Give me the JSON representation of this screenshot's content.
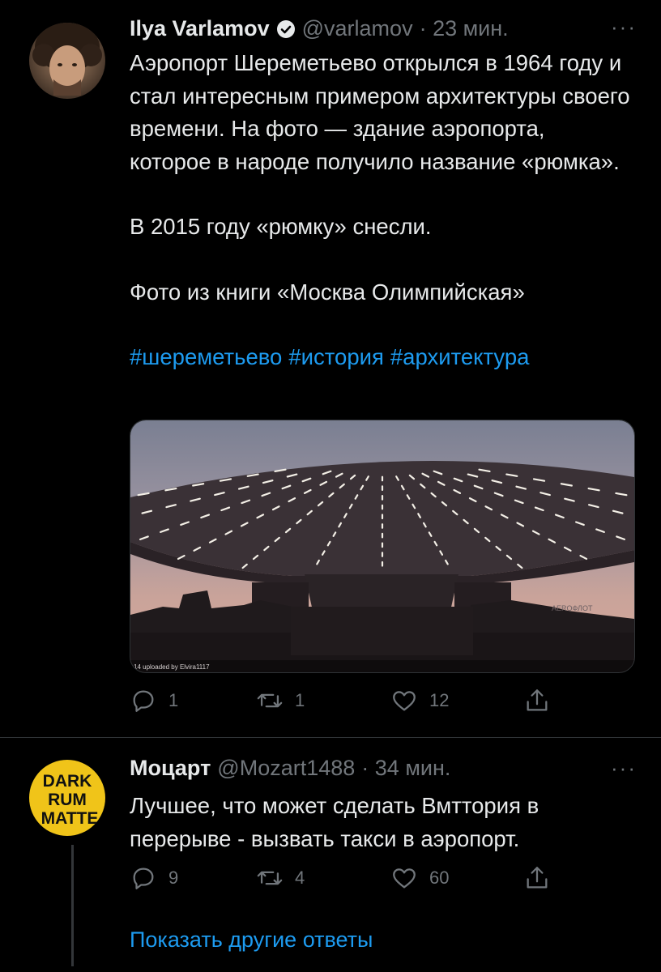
{
  "main_tweet": {
    "author_name": "Ilya Varlamov",
    "handle": "@varlamov",
    "time": "· 23 мин.",
    "more": "···",
    "paragraphs": [
      "Аэропорт Шереметьево открылся в 1964 году и стал интересным примером архитектуры своего времени. На фото — здание аэропорта, которое в народе получило название «рюмка».",
      "В 2015 году «рюмку» снесли.",
      "Фото из книги «Москва Олимпийская»"
    ],
    "hashtags": [
      "#шереметьево",
      "#история",
      "#архитектура"
    ],
    "media_watermark": "14  uploaded by Elvira1117",
    "media_sign": "AEROФЛОТ",
    "stats": {
      "replies": "1",
      "retweets": "1",
      "likes": "12"
    }
  },
  "reply_tweet": {
    "author_name": "Моцарт",
    "handle": "@Mozart1488",
    "time": "· 34 мин.",
    "more": "···",
    "avatar_text": [
      "DARK",
      "RUM",
      "MATTE"
    ],
    "text": "Лучшее, что может сделать Вмттория в перерыве - вызвать такси в аэропорт.",
    "stats": {
      "replies": "9",
      "retweets": "4",
      "likes": "60"
    }
  },
  "show_more_replies": "Показать другие ответы",
  "colors": {
    "background": "#000000",
    "link": "#1d9bf0",
    "muted": "#71767b",
    "avatar_yellow": "#f0c419"
  },
  "icons": [
    "verified-icon",
    "reply-icon",
    "retweet-icon",
    "like-icon",
    "share-icon"
  ]
}
